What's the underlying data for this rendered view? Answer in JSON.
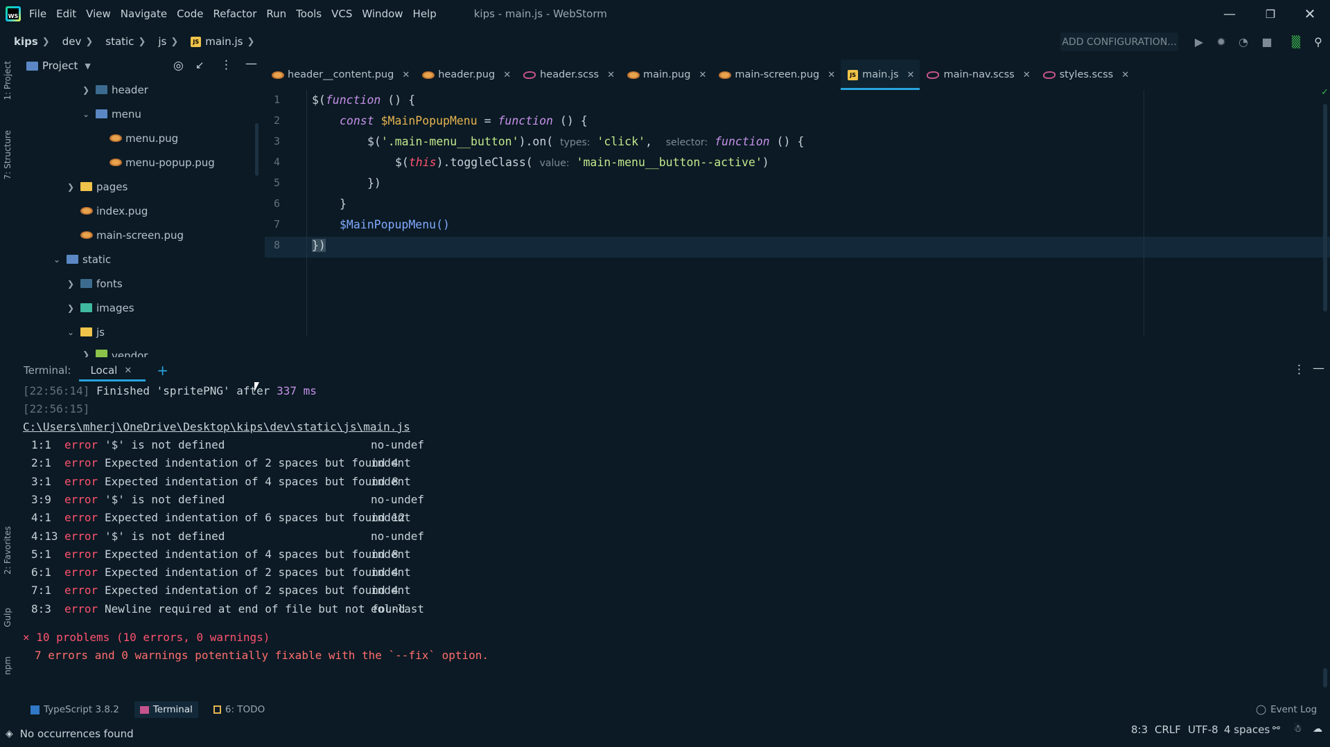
{
  "window": {
    "title": "kips - main.js - WebStorm",
    "menu": [
      "File",
      "Edit",
      "View",
      "Navigate",
      "Code",
      "Refactor",
      "Run",
      "Tools",
      "VCS",
      "Window",
      "Help"
    ]
  },
  "breadcrumbs": [
    "kips",
    "dev",
    "static",
    "js",
    "main.js"
  ],
  "toolbar": {
    "add_config": "ADD CONFIGURATION..."
  },
  "sidebar_labels": {
    "project": "1: Project",
    "structure": "7: Structure",
    "favorites": "2: Favorites",
    "gulp": "Gulp",
    "npm": "npm"
  },
  "project": {
    "title": "Project",
    "tree": [
      {
        "label": "header",
        "type": "folder",
        "expanded": false
      },
      {
        "label": "menu",
        "type": "folder",
        "expanded": true
      },
      {
        "label": "menu.pug",
        "type": "pug"
      },
      {
        "label": "menu-popup.pug",
        "type": "pug"
      },
      {
        "label": "pages",
        "type": "folder",
        "expanded": false
      },
      {
        "label": "index.pug",
        "type": "pug"
      },
      {
        "label": "main-screen.pug",
        "type": "pug"
      },
      {
        "label": "static",
        "type": "folder",
        "expanded": true
      },
      {
        "label": "fonts",
        "type": "folder",
        "expanded": false
      },
      {
        "label": "images",
        "type": "folder",
        "expanded": false
      },
      {
        "label": "js",
        "type": "folder",
        "expanded": true
      },
      {
        "label": "vendor",
        "type": "folder",
        "expanded": false
      }
    ]
  },
  "tabs": [
    {
      "label": "header__content.pug",
      "type": "pug"
    },
    {
      "label": "header.pug",
      "type": "pug"
    },
    {
      "label": "header.scss",
      "type": "scss"
    },
    {
      "label": "main.pug",
      "type": "pug"
    },
    {
      "label": "main-screen.pug",
      "type": "pug"
    },
    {
      "label": "main.js",
      "type": "js",
      "active": true
    },
    {
      "label": "main-nav.scss",
      "type": "scss"
    },
    {
      "label": "styles.scss",
      "type": "scss"
    }
  ],
  "code": {
    "line_numbers": [
      "1",
      "2",
      "3",
      "4",
      "5",
      "6",
      "7",
      "8"
    ],
    "l1_a": "$(",
    "l1_kw": "function",
    "l1_b": " () {",
    "l2_kw1": "const",
    "l2_id": " $MainPopupMenu",
    "l2_eq": " = ",
    "l2_kw2": "function",
    "l2_b": " () {",
    "l3_a": "$(",
    "l3_str": "'.main-menu__button'",
    "l3_b": ").on(",
    "l3_hint1": "types:",
    "l3_str2": "'click'",
    "l3_c": ",",
    "l3_hint2": "selector:",
    "l3_kw": "function",
    "l3_d": " () {",
    "l4_a": "$(",
    "l4_th": "this",
    "l4_b": ").toggleClass(",
    "l4_hint": "value:",
    "l4_str": "'main-menu__button--active'",
    "l4_c": ")",
    "l5": "})",
    "l6": "}",
    "l7": "$MainPopupMenu()",
    "l8": "})"
  },
  "terminal": {
    "label": "Terminal:",
    "tab": "Local",
    "lines": {
      "t1_ts": "[22:56:14]",
      "t1_a": " Finished ",
      "t1_b": "'spritePNG'",
      "t1_c": " after ",
      "t1_num": "337 ms",
      "t2_ts": "[22:56:15]",
      "path": "C:\\Users\\mherj\\OneDrive\\Desktop\\kips\\dev\\static\\js\\main.js"
    },
    "errors": [
      {
        "pos": "1:1",
        "level": "error",
        "msg": "'$' is not defined",
        "rule": "no-undef"
      },
      {
        "pos": "2:1",
        "level": "error",
        "msg": "Expected indentation of 2 spaces but found 4",
        "rule": "indent"
      },
      {
        "pos": "3:1",
        "level": "error",
        "msg": "Expected indentation of 4 spaces but found 8",
        "rule": "indent"
      },
      {
        "pos": "3:9",
        "level": "error",
        "msg": "'$' is not defined",
        "rule": "no-undef"
      },
      {
        "pos": "4:1",
        "level": "error",
        "msg": "Expected indentation of 6 spaces but found 12",
        "rule": "indent"
      },
      {
        "pos": "4:13",
        "level": "error",
        "msg": "'$' is not defined",
        "rule": "no-undef"
      },
      {
        "pos": "5:1",
        "level": "error",
        "msg": "Expected indentation of 4 spaces but found 8",
        "rule": "indent"
      },
      {
        "pos": "6:1",
        "level": "error",
        "msg": "Expected indentation of 2 spaces but found 4",
        "rule": "indent"
      },
      {
        "pos": "7:1",
        "level": "error",
        "msg": "Expected indentation of 2 spaces but found 4",
        "rule": "indent"
      },
      {
        "pos": "8:3",
        "level": "error",
        "msg": "Newline required at end of file but not found",
        "rule": "eol-last"
      }
    ],
    "summary1": "× 10 problems (10 errors, 0 warnings)",
    "summary2": "7 errors and 0 warnings potentially fixable with the `--fix` option."
  },
  "bottom_tools": [
    {
      "label": "TypeScript 3.8.2"
    },
    {
      "label": "Terminal",
      "active": true
    },
    {
      "label": "6: TODO"
    }
  ],
  "event_log": "Event Log",
  "status": {
    "message": "No occurrences found",
    "position": "8:3",
    "line_sep": "CRLF",
    "encoding": "UTF-8",
    "indent": "4 spaces"
  },
  "colors": {
    "accent": "#2aa4de",
    "background": "#0b1a24",
    "error": "#ff5370"
  }
}
